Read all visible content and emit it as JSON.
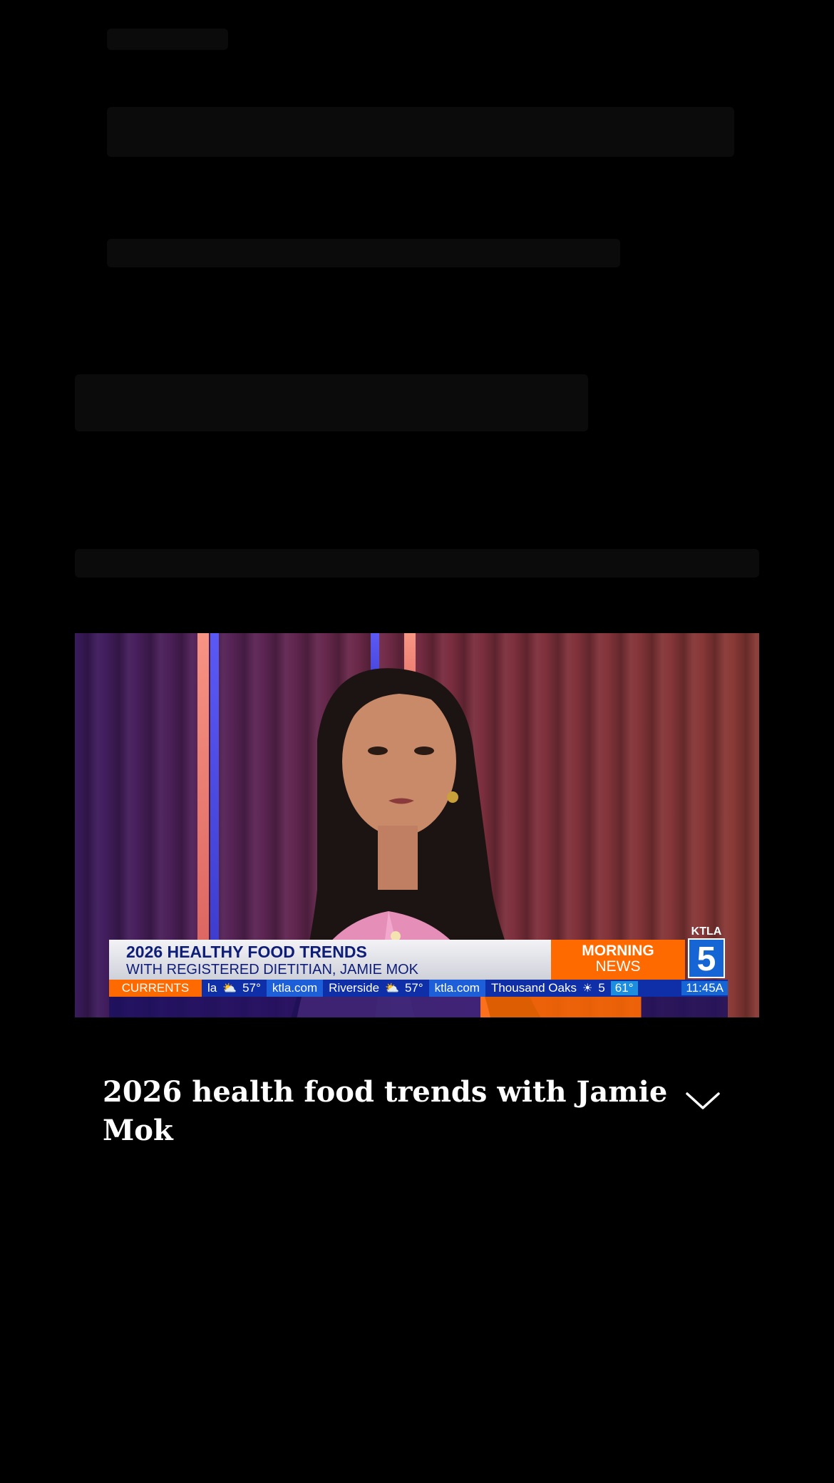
{
  "video": {
    "lower_third": {
      "title": "2026 HEALTHY FOOD TRENDS",
      "subtitle": "WITH REGISTERED DIETITIAN, JAMIE MOK",
      "show_line1": "MORNING",
      "show_line2": "NEWS",
      "station_call": "KTLA",
      "station_number": "5"
    },
    "ticker": {
      "label": "CURRENTS",
      "items": [
        "la",
        "57°",
        "ktla.com",
        "Riverside",
        "57°",
        "ktla.com",
        "Thousand Oaks",
        "5"
      ],
      "temp": "61°",
      "time": "11:45A"
    }
  },
  "caption": {
    "title": "2026 health food trends with Jamie Mok"
  },
  "icons": {
    "expand": "chevron-down-icon",
    "weather_partly": "partly-cloudy-icon",
    "weather_sun": "sun-icon"
  },
  "colors": {
    "background": "#000000",
    "ktla_orange": "#ff6a00",
    "ktla_blue": "#1566d4",
    "title_navy": "#0d1d78"
  }
}
